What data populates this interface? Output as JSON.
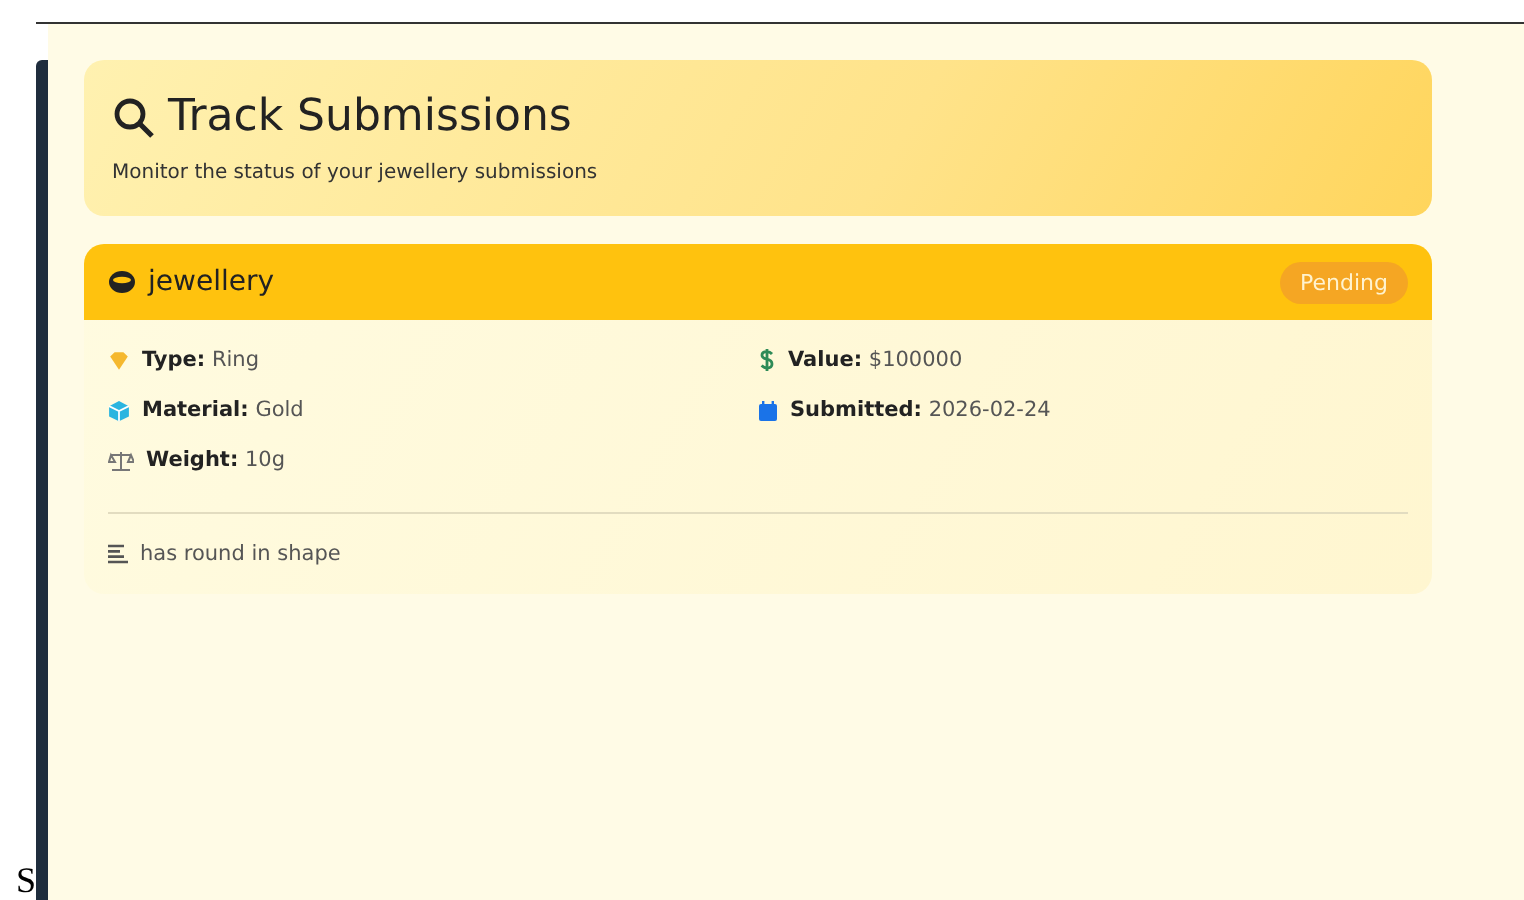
{
  "header": {
    "title": "Track Submissions",
    "subtitle": "Monitor the status of your jewellery submissions"
  },
  "submission": {
    "name": "jewellery",
    "status": "Pending",
    "fields": [
      {
        "kind": "type",
        "label": "Type:",
        "value": "Ring"
      },
      {
        "kind": "value",
        "label": "Value:",
        "value": "$100000"
      },
      {
        "kind": "material",
        "label": "Material:",
        "value": "Gold"
      },
      {
        "kind": "submitted",
        "label": "Submitted:",
        "value": "2026-02-24"
      },
      {
        "kind": "weight",
        "label": "Weight:",
        "value": "10g"
      }
    ],
    "description": "has round in shape"
  },
  "stray_text": "S"
}
